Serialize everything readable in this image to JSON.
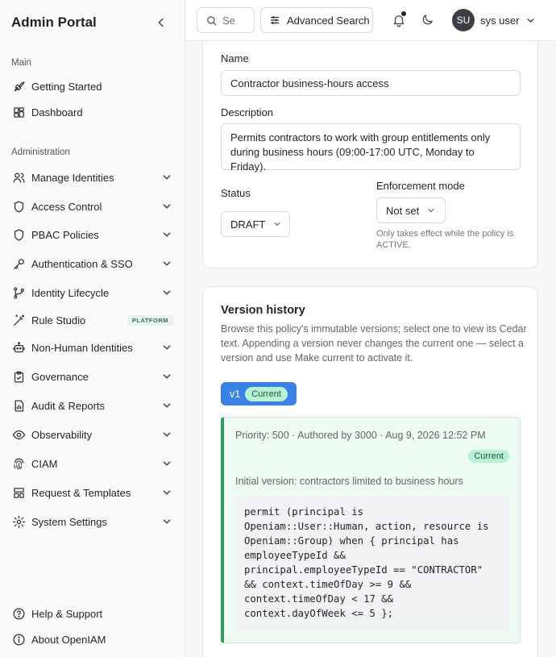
{
  "app": {
    "title": "Admin Portal"
  },
  "sidebar": {
    "sections": [
      {
        "label": "Main"
      },
      {
        "label": "Administration"
      }
    ],
    "main_items": [
      {
        "label": "Getting Started",
        "icon": "rocket-icon"
      },
      {
        "label": "Dashboard",
        "icon": "dashboard-icon"
      }
    ],
    "admin_items": [
      {
        "label": "Manage Identities",
        "icon": "users-icon"
      },
      {
        "label": "Access Control",
        "icon": "shield-icon"
      },
      {
        "label": "PBAC Policies",
        "icon": "shield-icon"
      },
      {
        "label": "Authentication & SSO",
        "icon": "key-icon"
      },
      {
        "label": "Identity Lifecycle",
        "icon": "branch-icon"
      },
      {
        "label": "Rule Studio",
        "icon": "wand-icon",
        "badge": "PLATFORM"
      },
      {
        "label": "Non-Human Identities",
        "icon": "robot-icon"
      },
      {
        "label": "Governance",
        "icon": "clipboard-check-icon"
      },
      {
        "label": "Audit & Reports",
        "icon": "report-icon"
      },
      {
        "label": "Observability",
        "icon": "eye-icon"
      },
      {
        "label": "CIAM",
        "icon": "fingerprint-icon"
      },
      {
        "label": "Request & Templates",
        "icon": "template-icon"
      },
      {
        "label": "System Settings",
        "icon": "gear-icon"
      }
    ],
    "footer_items": [
      {
        "label": "Help & Support",
        "icon": "help-icon"
      },
      {
        "label": "About OpenIAM",
        "icon": "info-icon"
      }
    ]
  },
  "topbar": {
    "search_placeholder": "Se",
    "advanced_search_label": "Advanced Search",
    "user": {
      "initials": "SU",
      "name": "sys user"
    }
  },
  "policy_form": {
    "name_label": "Name",
    "name_value": "Contractor business-hours access",
    "description_label": "Description",
    "description_value": "Permits contractors to work with group entitlements only during business hours (09:00-17:00 UTC, Monday to Friday).",
    "status_label": "Status",
    "status_value": "DRAFT",
    "enforcement_label": "Enforcement mode",
    "enforcement_value": "Not set",
    "enforcement_help": "Only takes effect while the policy is ACTIVE."
  },
  "version_history": {
    "title": "Version history",
    "description": "Browse this policy's immutable versions; select one to view its Cedar text. Appending a version never changes the current one — select a version and use Make current to activate it.",
    "versions": [
      {
        "label": "v1",
        "badge": "Current"
      }
    ],
    "selected": {
      "meta": "Priority: 500  · Authored by 3000  · Aug 9, 2026 12:52 PM",
      "badge": "Current",
      "comment": "Initial version: contractors limited to business hours",
      "code": "permit (principal is\nOpeniam::User::Human, action, resource is\nOpeniam::Group) when { principal has\nemployeeTypeId &&\nprincipal.employeeTypeId == \"CONTRACTOR\"\n&& context.timeOfDay >= 9 &&\ncontext.timeOfDay < 17 &&\ncontext.dayOfWeek <= 5 };"
    }
  },
  "colors": {
    "accent": "#3b82e6",
    "current_badge_bg": "#b8f0d4",
    "panel_border": "#2f9e5a"
  }
}
